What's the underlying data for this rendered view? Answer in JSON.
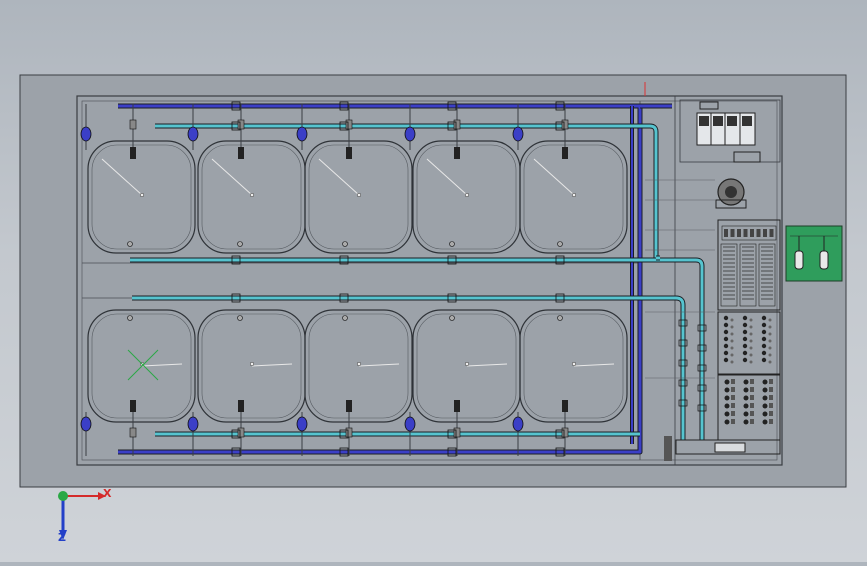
{
  "viewport": {
    "background_top": "#aeb5bd",
    "background_bottom": "#cfd3d8",
    "frame_color": "#3a3d42",
    "slab_color": "#9ca2a9",
    "tank_stroke": "#2f3338",
    "pipe_blue": "#3b3fc7",
    "pipe_cyan": "#56c4cf",
    "panel_green": "#2f9d5c"
  },
  "tank_rows": [
    {
      "name": "upper-row",
      "tanks": 5
    },
    {
      "name": "lower-row",
      "tanks": 5
    }
  ],
  "triad": {
    "x_label": "X",
    "z_label": "Z",
    "x_color": "#d42a2a",
    "y_color": "#2aa845",
    "z_color": "#2340c8"
  }
}
